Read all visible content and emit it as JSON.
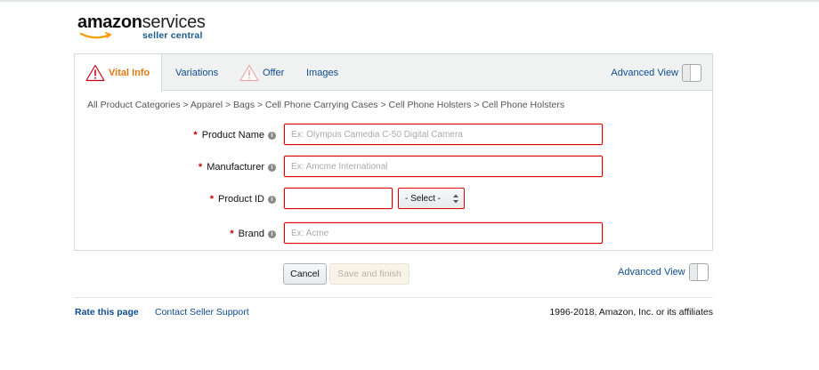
{
  "logo": {
    "word": "amazon",
    "services": "services",
    "sub": "seller central"
  },
  "tabs": [
    {
      "label": "Vital Info",
      "warning": true,
      "active": true
    },
    {
      "label": "Variations",
      "warning": false,
      "active": false
    },
    {
      "label": "Offer",
      "warning": true,
      "active": false
    },
    {
      "label": "Images",
      "warning": false,
      "active": false
    }
  ],
  "advanced_view_label": "Advanced View",
  "breadcrumb": "All Product Categories > Apparel > Bags > Cell Phone Carrying Cases > Cell Phone Holsters > Cell Phone Holsters",
  "form": {
    "product_name": {
      "label": "Product Name",
      "placeholder": "Ex: Olympus Camedia C-50 Digital Camera"
    },
    "manufacturer": {
      "label": "Manufacturer",
      "placeholder": "Ex: Amcme International"
    },
    "product_id": {
      "label": "Product ID",
      "value": "",
      "select_value": "- Select -"
    },
    "brand": {
      "label": "Brand",
      "placeholder": "Ex: Acme"
    },
    "required_marker": "*",
    "info_glyph": "i"
  },
  "buttons": {
    "cancel": "Cancel",
    "save": "Save and finish"
  },
  "footer": {
    "rate": "Rate this page",
    "contact": "Contact Seller Support",
    "copyright": "1996-2018, Amazon, Inc. or its affiliates"
  },
  "colors": {
    "accent_orange": "#e47911",
    "link_blue": "#0f4b8f",
    "error_red": "#dd0000"
  }
}
